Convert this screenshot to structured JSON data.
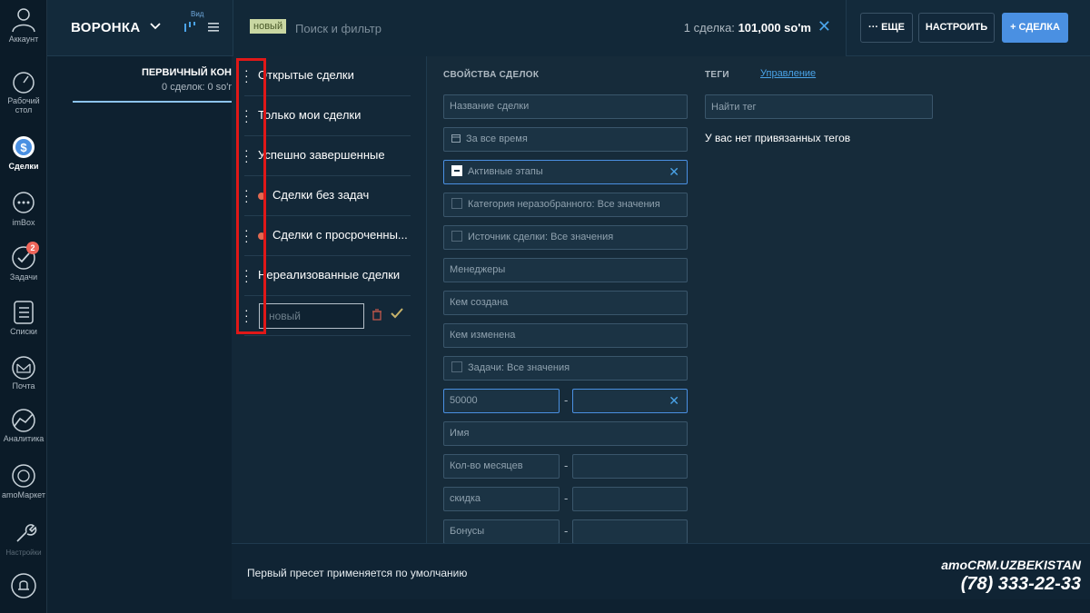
{
  "sidebar": {
    "items": [
      {
        "label": "Аккаунт",
        "icon": "account-icon"
      },
      {
        "label": "Рабочий стол",
        "icon": "dashboard-icon"
      },
      {
        "label": "Сделки",
        "icon": "deals-icon",
        "active": true
      },
      {
        "label": "imBox",
        "icon": "chat-icon"
      },
      {
        "label": "Задачи",
        "icon": "tasks-icon",
        "badge": "2"
      },
      {
        "label": "Списки",
        "icon": "lists-icon"
      },
      {
        "label": "Почта",
        "icon": "mail-icon"
      },
      {
        "label": "Аналитика",
        "icon": "analytics-icon"
      },
      {
        "label": "amoМаркет",
        "icon": "market-icon"
      },
      {
        "label": "Настройки",
        "icon": "settings-icon"
      }
    ]
  },
  "header": {
    "funnel_label": "ВОРОНКА",
    "view_label": "Вид",
    "search": {
      "tag": "новый",
      "placeholder": "Поиск и фильтр"
    },
    "deal_count_prefix": "1 сделка:",
    "deal_count_value": "101,000 so'm",
    "more_button": "··· ЕЩЕ",
    "configure_button": "НАСТРОИТЬ",
    "add_deal_button": "+ СДЕЛКА"
  },
  "board": {
    "column_title": "ПЕРВИЧНЫЙ КОН",
    "column_subtitle": "0 сделок: 0 so'r"
  },
  "presets": {
    "items": [
      {
        "label": "Открытые сделки"
      },
      {
        "label": "Только мои сделки"
      },
      {
        "label": "Успешно завершенные"
      },
      {
        "label": "Сделки без задач"
      },
      {
        "label": "Сделки с просроченны..."
      },
      {
        "label": "Нереализованные сделки"
      }
    ],
    "new_placeholder": "новый"
  },
  "properties": {
    "title": "СВОЙСТВА СДЕЛОК",
    "deal_name": "Название сделки",
    "period": "За все время",
    "stages": "Активные этапы",
    "category": "Категория неразобранного: Все значения",
    "source": "Источник сделки: Все значения",
    "managers": "Менеджеры",
    "created_by": "Кем создана",
    "modified_by": "Кем изменена",
    "tasks": "Задачи: Все значения",
    "budget_from": "50000",
    "name": "Имя",
    "months": "Кол-во месяцев",
    "discount": "скидка",
    "bonuses": "Бонусы",
    "dash": "-"
  },
  "tags": {
    "title": "ТЕГИ",
    "manage_link": "Управление",
    "search_placeholder": "Найти тег",
    "empty_text": "У вас нет привязанных тегов"
  },
  "footer": {
    "text": "Первый пресет применяется по умолчанию"
  },
  "brand": {
    "line1": "amoCRM.UZBEKISTAN",
    "phone": "(78) 333-22-33"
  },
  "colors": {
    "accent": "#4a90e2",
    "highlight": "#e01818",
    "badge": "#f0655a"
  }
}
